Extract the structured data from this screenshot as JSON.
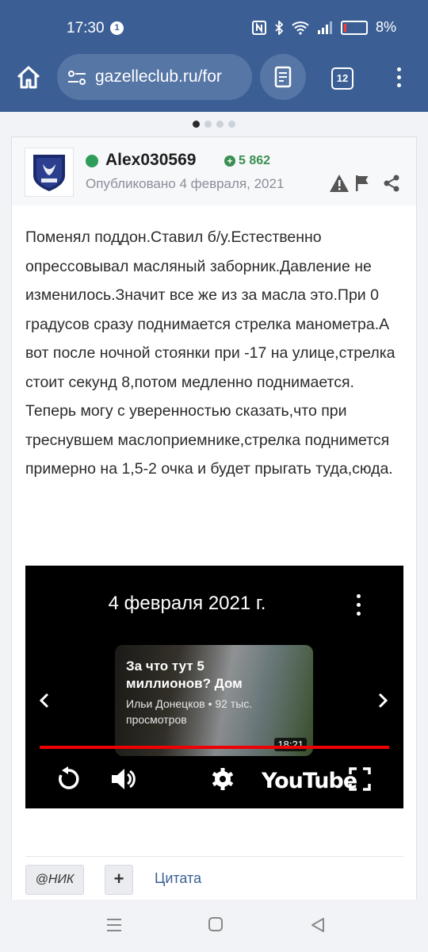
{
  "status_bar": {
    "time": "17:30",
    "notification_count": "1",
    "battery_percent": "8%"
  },
  "browser": {
    "url": "gazelleclub.ru/for",
    "tab_count": "12"
  },
  "pager": {
    "total": 4,
    "active_index": 0
  },
  "post": {
    "author": "Alex030569",
    "reputation": "5 862",
    "posted": "Опубликовано 4 февраля, 2021",
    "body": [
      "Поменял поддон.Ставил б/у.Естественно опрессовывал масляный заборник.Давление не изменилось.Значит все же из за масла это.При 0 градусов сразу поднимается стрелка манометра.А вот после ночной стоянки при -17 на улице,стрелка стоит секунд 8,потом медленно поднимается.",
      "Теперь могу с уверенностью сказать,что при треснувшем маслоприемнике,стрелка поднимется примерно на 1,5-2 очка и будет прыгать туда,сюда."
    ]
  },
  "video": {
    "title": "4 февраля 2021 г.",
    "suggested": {
      "title": "За что тут 5 миллионов? Дом",
      "meta": "Ильи Донецков • 92 тыс. просмотров",
      "duration": "18:21"
    },
    "brand": "YouTube",
    "progress": 1.0
  },
  "post_actions": {
    "mention_label": "@НИК",
    "plus_label": "+",
    "quote_label": "Цитата"
  },
  "colors": {
    "chrome": "#3b5f95",
    "online": "#2e9d5a",
    "reputation": "#3a8f52",
    "progress": "#ee0000"
  }
}
